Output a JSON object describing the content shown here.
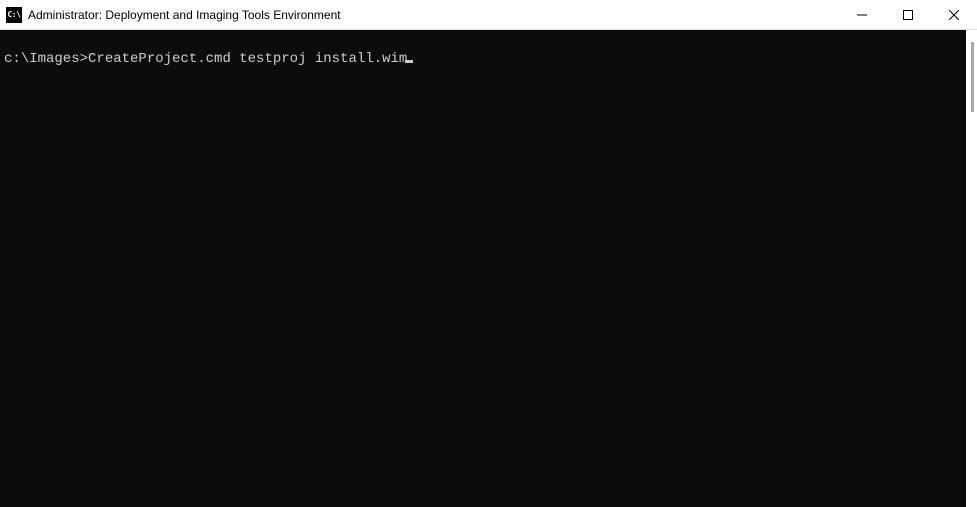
{
  "window": {
    "icon_label": "C:\\",
    "title": "Administrator: Deployment and Imaging Tools Environment"
  },
  "terminal": {
    "prompt": "c:\\Images>",
    "command": "CreateProject.cmd testproj install.wim"
  }
}
